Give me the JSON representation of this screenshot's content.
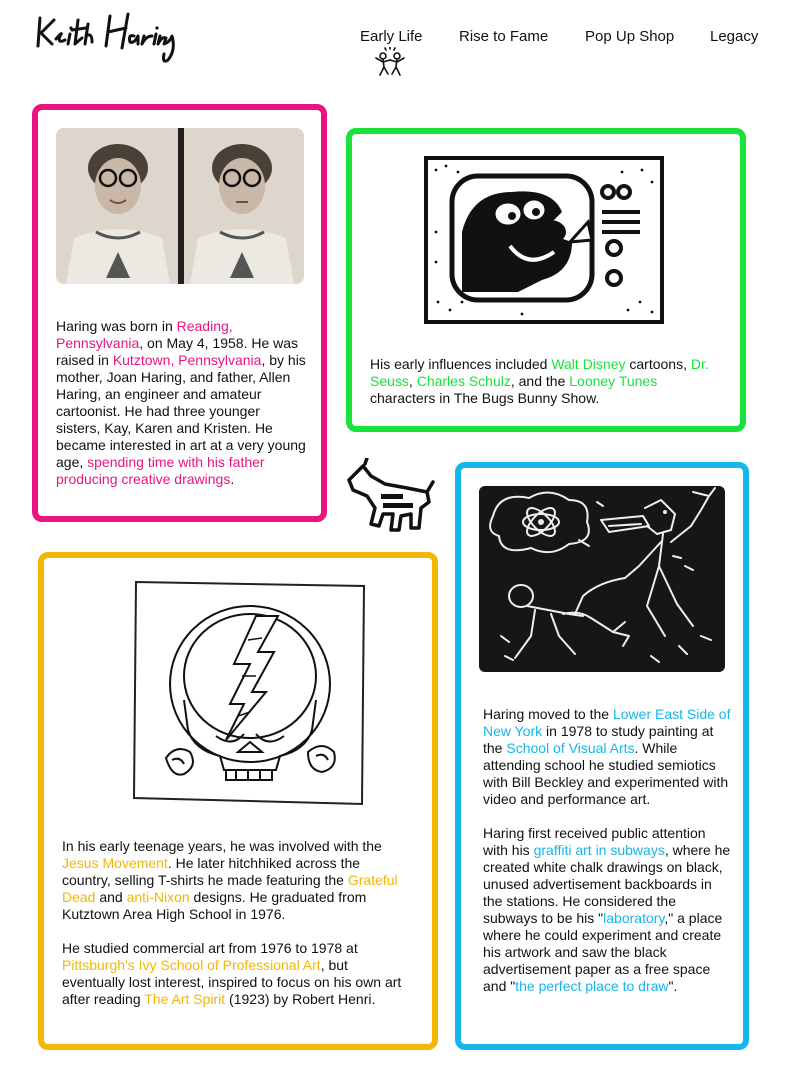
{
  "site": {
    "logo_text": "Keith Haring",
    "logo_icon": "signature-logo"
  },
  "nav": {
    "items": [
      {
        "label": "Early Life",
        "active": true
      },
      {
        "label": "Rise to Fame"
      },
      {
        "label": "Pop Up Shop"
      },
      {
        "label": "Legacy"
      }
    ],
    "active_marker_icon": "dancing-figures-icon"
  },
  "colors": {
    "pink": "#e8157f",
    "green": "#19e33a",
    "yellow": "#f2b705",
    "blue": "#16b6ec"
  },
  "cards": {
    "childhood": {
      "image_icon": "photo-booth-portraits",
      "p1": {
        "t1": "Haring was born in ",
        "l1": "Reading, Pennsylvania",
        "t2": ", on May 4, 1958. He was raised in ",
        "l2": "Kutztown, Pennsylvania",
        "t3": ", by his mother, Joan Haring, and father, Allen Haring, an engineer and amateur cartoonist. He had three younger sisters, Kay, Karen and Kristen. He became interested in art at a very young age, ",
        "l3": "spending time with his father producing creative drawings",
        "t4": "."
      }
    },
    "influences": {
      "image_icon": "cartoon-tv-drawing",
      "p1": {
        "t1": "His early influences included ",
        "l1": "Walt Disney",
        "t2": " cartoons, ",
        "l2": "Dr. Seuss",
        "t3": ", ",
        "l3": "Charles Schulz",
        "t4": ", and the ",
        "l4": "Looney Tunes",
        "t5": " characters in The Bugs Bunny Show."
      }
    },
    "teen": {
      "image_icon": "grateful-dead-skull-drawing",
      "p1": {
        "t1": "In his early teenage years, he was involved with the ",
        "l1": "Jesus Movement",
        "t2": ". He later hitchhiked across the country, selling T-shirts he made featuring the ",
        "l2": "Grateful Dead",
        "t3": " and ",
        "l3": "anti-Nixon",
        "t4": " designs. He graduated from Kutztown Area High School in 1976."
      },
      "p2": {
        "t1": "He studied commercial art from 1976 to 1978 at ",
        "l1": "Pittsburgh's Ivy School of Professional Art",
        "t2": ", but eventually lost interest, inspired to focus on his own art after reading ",
        "l2": "The Art Spirit",
        "t3": " (1923) by Robert Henri."
      }
    },
    "nyc": {
      "image_icon": "subway-chalk-drawing",
      "p1": {
        "t1": "Haring moved to the ",
        "l1": "Lower East Side of New York",
        "t2": " in 1978 to study painting at the ",
        "l2": "School of Visual Arts",
        "t3": ". While attending school he studied semiotics with Bill Beckley and experimented with video and performance art."
      },
      "p2": {
        "t1": "Haring first received public attention with his ",
        "l1": "graffiti art in subways",
        "t2": ", where he created white chalk drawings on black, unused advertisement backboards in the stations. He considered the subways to be his \"",
        "l2": "laboratory",
        "t3": ",\" a place where he could experiment and create his artwork and saw the black advertisement paper as a free space and \"",
        "l3": "the perfect place to draw",
        "t4": "\"."
      }
    }
  },
  "decor": {
    "barking_dog_icon": "barking-dog-icon"
  }
}
